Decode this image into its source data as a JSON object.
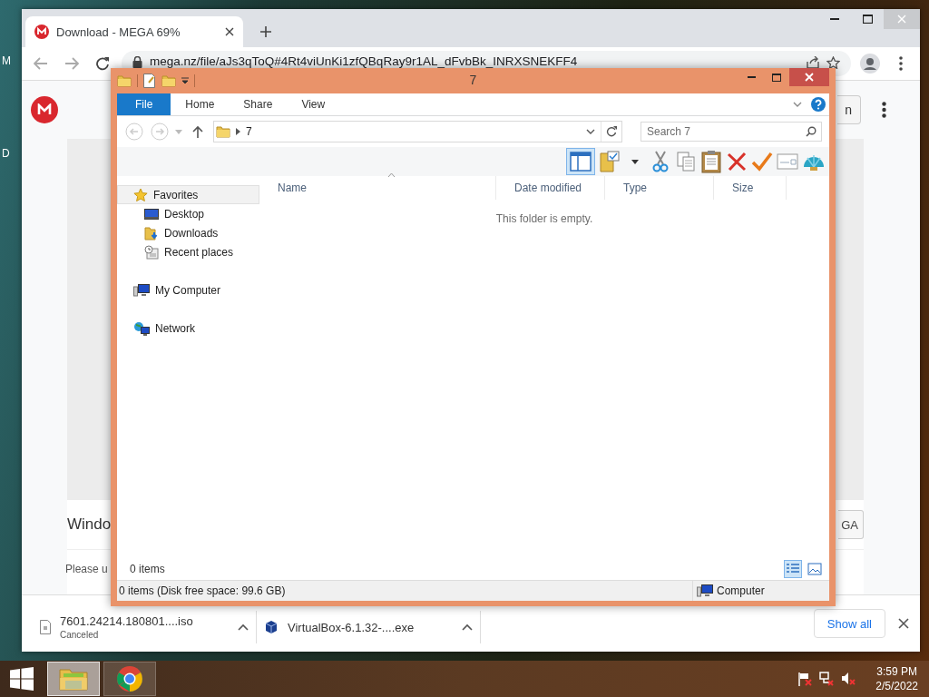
{
  "desktop": {
    "icon_labels": [
      "M",
      "D"
    ]
  },
  "browser": {
    "tabs": [
      {
        "title": "Download - MEGA 69%",
        "selected": true
      }
    ],
    "address": "mega.nz/file/aJs3qToQ#4Rt4viUnKi1zfQBqRay9r1AL_dFvbBk_INRXSNEKFF4",
    "page": {
      "header_button": "n",
      "card_title": "Windo",
      "card_button": "GA",
      "card_text": "Please u"
    },
    "downloads": [
      {
        "name": "7601.24214.180801....iso",
        "status": "Canceled"
      },
      {
        "name": "VirtualBox-6.1.32-....exe"
      }
    ],
    "show_all": "Show all"
  },
  "explorer": {
    "title": "7",
    "ribbon_tabs": [
      {
        "label": "File",
        "selected": true
      },
      {
        "label": "Home",
        "selected": false
      },
      {
        "label": "Share",
        "selected": false
      },
      {
        "label": "View",
        "selected": false
      }
    ],
    "path": [
      "7"
    ],
    "search": {
      "placeholder": "Search 7"
    },
    "nav": [
      {
        "label": "Favorites",
        "kind": "star",
        "selected": true,
        "children": [
          {
            "label": "Desktop",
            "kind": "desktop",
            "selected": false
          },
          {
            "label": "Downloads",
            "kind": "downloads",
            "selected": false
          },
          {
            "label": "Recent places",
            "kind": "recent",
            "selected": false
          }
        ]
      },
      {
        "label": "My Computer",
        "kind": "computer",
        "selected": false
      },
      {
        "label": "Network",
        "kind": "network",
        "selected": false
      }
    ],
    "columns": [
      "Name",
      "Date modified",
      "Type",
      "Size"
    ],
    "empty_message": "This folder is empty.",
    "item_count": "0 items",
    "status_bar": {
      "summary": "0 items (Disk free space: 99.6 GB)",
      "location": "Computer"
    }
  },
  "taskbar": {
    "apps": [
      {
        "kind": "explorer",
        "selected": true
      },
      {
        "kind": "chrome",
        "selected": false
      }
    ],
    "time": "3:59 PM",
    "date": "2/5/2022"
  }
}
